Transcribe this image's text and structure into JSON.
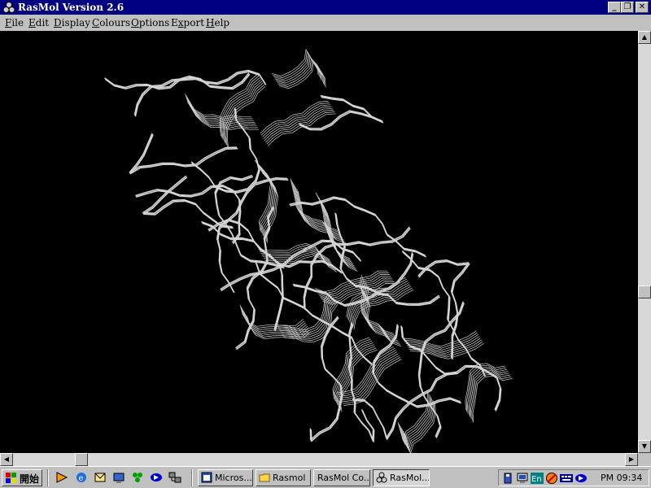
{
  "window": {
    "title": "RasMol Version 2.6"
  },
  "menu": {
    "items": [
      "File",
      "Edit",
      "Display",
      "Colours",
      "Options",
      "Export",
      "Help"
    ],
    "mnemonic_index": [
      0,
      0,
      0,
      0,
      0,
      1,
      0
    ]
  },
  "taskbar": {
    "start_label": "開始",
    "tasks": [
      "Micros...",
      "Rasmol",
      "RasMol Co...",
      "RasMol..."
    ],
    "clock": "PM 09:34",
    "tray_lang": "En"
  },
  "colors": {
    "title_bg": "#000080",
    "canvas_bg": "#000000",
    "ribbon": "#d4d4d4",
    "chrome": "#c0c0c0"
  }
}
